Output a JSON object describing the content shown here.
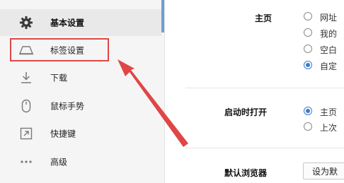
{
  "sidebar": {
    "items": [
      {
        "label": "基本设置",
        "icon": "gear-icon",
        "active": true
      },
      {
        "label": "标签设置",
        "icon": "tab-icon",
        "highlighted": true
      },
      {
        "label": "下载",
        "icon": "download-icon"
      },
      {
        "label": "鼠标手势",
        "icon": "mouse-icon"
      },
      {
        "label": "快捷键",
        "icon": "shortcut-icon"
      },
      {
        "label": "高级",
        "icon": "more-icon"
      }
    ]
  },
  "settings": {
    "homepage": {
      "label": "主页",
      "options": [
        {
          "label": "网址",
          "checked": false
        },
        {
          "label": "我的",
          "checked": false
        },
        {
          "label": "空白",
          "checked": false
        },
        {
          "label": "自定",
          "checked": true
        }
      ]
    },
    "startup": {
      "label": "启动时打开",
      "options": [
        {
          "label": "主页",
          "checked": true
        },
        {
          "label": "上次",
          "checked": false
        }
      ]
    },
    "default_browser": {
      "label": "默认浏览器",
      "button_label": "设为默"
    }
  },
  "colors": {
    "accent": "#3b79c8",
    "highlight": "#e04646",
    "sidebar_bg": "#f5f5f5"
  }
}
